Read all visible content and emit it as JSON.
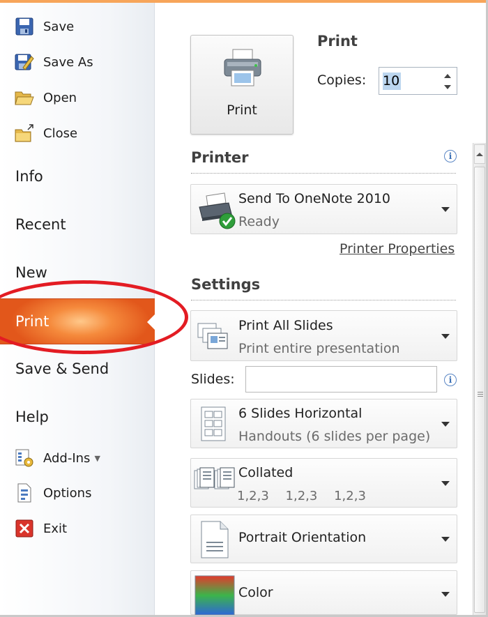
{
  "sidebar": {
    "commands": [
      {
        "label": "Save",
        "icon": "save-icon"
      },
      {
        "label": "Save As",
        "icon": "save-as-icon"
      },
      {
        "label": "Open",
        "icon": "open-folder-icon"
      },
      {
        "label": "Close",
        "icon": "close-folder-icon"
      }
    ],
    "tabs": {
      "info": "Info",
      "recent": "Recent",
      "new": "New",
      "print": "Print",
      "save_send": "Save & Send",
      "help": "Help"
    },
    "bottom_commands": [
      {
        "label": "Add-Ins",
        "icon": "add-ins-icon"
      },
      {
        "label": "Options",
        "icon": "options-icon"
      },
      {
        "label": "Exit",
        "icon": "exit-icon"
      }
    ],
    "selected_tab": "Print",
    "accent_color": "#f58a3c",
    "highlight_color": "#e31c23"
  },
  "print": {
    "button_label": "Print",
    "heading": "Print",
    "copies_label": "Copies:",
    "copies_value": "10"
  },
  "printer": {
    "heading": "Printer",
    "name": "Send To OneNote 2010",
    "status": "Ready",
    "properties_link": "Printer Properties"
  },
  "settings": {
    "heading": "Settings",
    "slides_label": "Slides:",
    "slides_value": "",
    "print_range": {
      "title": "Print All Slides",
      "subtitle": "Print entire presentation"
    },
    "layout": {
      "title": "6 Slides Horizontal",
      "subtitle": "Handouts (6 slides per page)"
    },
    "collation": {
      "title": "Collated",
      "sequence": [
        "1,2,3",
        "1,2,3",
        "1,2,3"
      ]
    },
    "orientation": {
      "title": "Portrait Orientation"
    },
    "color": {
      "title": "Color"
    }
  }
}
